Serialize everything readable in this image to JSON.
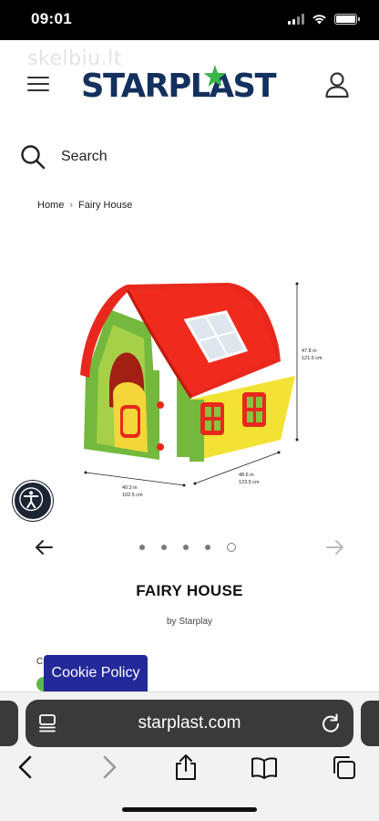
{
  "status_bar": {
    "time": "09:01"
  },
  "watermark": "skelbiu.lt",
  "header": {
    "logo_text": "STARPLAST",
    "logo_star_color": "#3ab54a",
    "brand_color": "#13305e"
  },
  "search": {
    "label": "Search"
  },
  "breadcrumb": {
    "home": "Home",
    "current": "Fairy House"
  },
  "product_image": {
    "height_in": "47.8 in",
    "height_cm": "121.5 cm",
    "width_in": "40.3 in",
    "width_cm": "102.5 cm",
    "depth_in": "48.6 in",
    "depth_cm": "123.5 cm"
  },
  "carousel": {
    "total": 5,
    "active_index": 4
  },
  "product": {
    "title": "FAIRY HOUSE",
    "brand": "by Starplay"
  },
  "cut_letter": "C",
  "cookie": {
    "label": "Cookie Policy",
    "color": "#24299a"
  },
  "browser": {
    "url": "starplast.com"
  }
}
